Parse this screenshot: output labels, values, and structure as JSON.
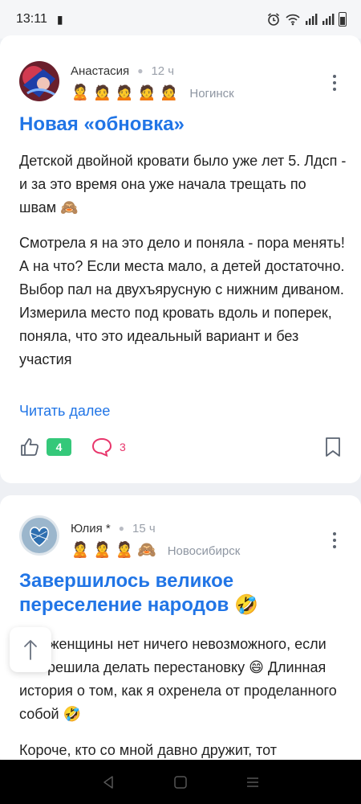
{
  "status_bar": {
    "time": "13:11",
    "left_icon": "▮",
    "right_icons": [
      "alarm-icon",
      "wifi-icon",
      "signal-icon",
      "signal-icon",
      "battery-icon"
    ]
  },
  "posts": [
    {
      "author": "Анастасия",
      "time": "12 ч",
      "city": "Ногинск",
      "badges": [
        "🙎",
        "🙍",
        "🙍",
        "🙍",
        "🙍"
      ],
      "title": "Новая «обновка»",
      "paragraphs": [
        "Детской двойной кровати было уже лет 5. Лдсп - и за это время она уже начала трещать по швам 🙈",
        "Смотрела я на это дело и поняла - пора менять! А на что? Если места мало, а детей достаточно. Выбор пал на двухъярусную с нижним диваном. Измерила место под кровать вдоль и поперек, поняла, что это идеальный вариант и без участия"
      ],
      "read_more": "Читать далее",
      "likes": "4",
      "comments": "3"
    },
    {
      "author": "Юлия *",
      "time": "15 ч",
      "city": "Новосибирск",
      "badges": [
        "🙎",
        "🙎",
        "🙎",
        "🙈"
      ],
      "title": "Завершилось великое переселение народов 🤣",
      "paragraphs": [
        "Для женщины нет ничего невозможного, если она решила делать перестановку 😄 Длинная история о том, как я охренела от проделанного собой 🤣",
        "Короче, кто со мной давно дружит, тот"
      ]
    }
  ],
  "colors": {
    "accent": "#2175e6",
    "like_badge": "#35c87a",
    "comment": "#e8356b"
  }
}
